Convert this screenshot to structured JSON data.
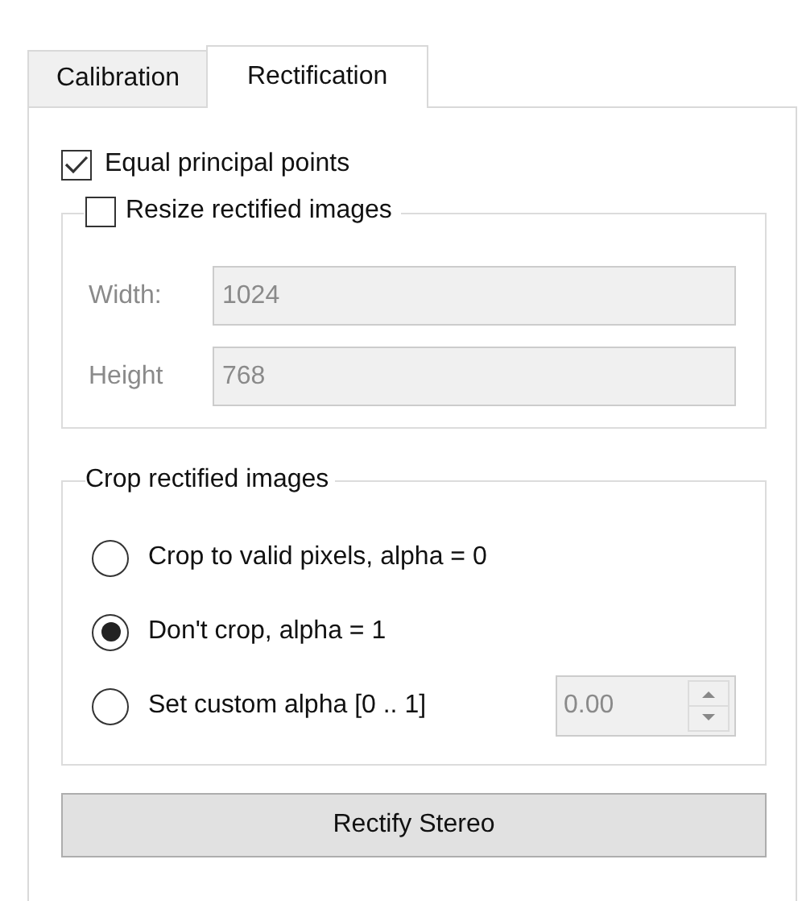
{
  "tabs": [
    {
      "label": "Calibration",
      "selected": false
    },
    {
      "label": "Rectification",
      "selected": true
    }
  ],
  "equal_principal_points": {
    "label": "Equal principal points",
    "checked": true
  },
  "resize_group": {
    "label": "Resize rectified images",
    "checked": false,
    "fields": [
      {
        "label": "Width:",
        "value": "1024",
        "disabled": true
      },
      {
        "label": "Height",
        "value": "768",
        "disabled": true
      }
    ]
  },
  "crop_group": {
    "title": "Crop rectified images",
    "options": [
      {
        "label": "Crop to valid pixels, alpha = 0",
        "selected": false
      },
      {
        "label": "Don't crop, alpha = 1",
        "selected": true
      },
      {
        "label": "Set custom alpha [0 .. 1]",
        "selected": false,
        "spinbox": {
          "value": "0.00",
          "disabled": true
        }
      }
    ]
  },
  "button": "Rectify Stereo"
}
